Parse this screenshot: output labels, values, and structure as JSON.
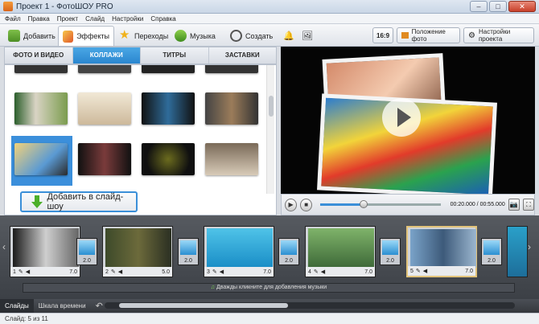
{
  "window": {
    "title": "Проект 1 - ФотоШОУ PRO",
    "minimize": "–",
    "maximize": "□",
    "close": "✕"
  },
  "menu": [
    "Файл",
    "Правка",
    "Проект",
    "Слайд",
    "Настройки",
    "Справка"
  ],
  "tabs": [
    {
      "label": "Добавить",
      "icon": "add-icon"
    },
    {
      "label": "Эффекты",
      "icon": "effects-brush-icon"
    },
    {
      "label": "Переходы",
      "icon": "star-transitions-icon"
    },
    {
      "label": "Музыка",
      "icon": "music-icon"
    },
    {
      "label": "Создать",
      "icon": "film-reel-icon"
    }
  ],
  "toolbar_right": {
    "aspect": "16:9",
    "photo_position": "Положение фото",
    "project_settings": "Настройки проекта"
  },
  "subtabs": [
    "ФОТО И ВИДЕО",
    "КОЛЛАЖИ",
    "ТИТРЫ",
    "ЗАСТАВКИ"
  ],
  "active_subtab": 1,
  "add_button": "Добавить в слайд-шоу",
  "player": {
    "time": "00:20.000 / 00:55.000",
    "progress": 0.36
  },
  "slides": [
    {
      "num": "1",
      "dur": "7.0"
    },
    {
      "num": "2",
      "dur": "5.0"
    },
    {
      "num": "3",
      "dur": "7.0"
    },
    {
      "num": "4",
      "dur": "7.0"
    },
    {
      "num": "5",
      "dur": "7.0"
    }
  ],
  "transitions": [
    "2.0",
    "2.0",
    "2.0",
    "2.0",
    "2.0"
  ],
  "music_hint": "Дважды кликните для добавления музыки",
  "bottom_tabs": [
    "Слайды",
    "Шкала времени"
  ],
  "status": "Слайд: 5 из 11",
  "colors": {
    "accent": "#2a86cf",
    "timeline_bg": "#44484e"
  }
}
